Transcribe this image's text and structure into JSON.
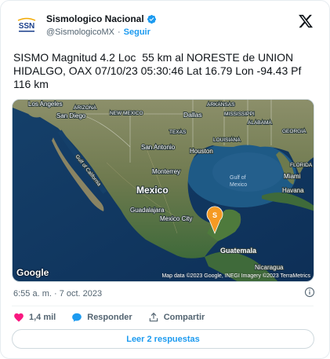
{
  "author": {
    "name": "Sismologico Nacional",
    "handle": "@SismologicoMX",
    "follow_label": "Seguir",
    "avatar_text": "SSN"
  },
  "tweet": {
    "text": "SISMO Magnitud 4.2 Loc  55 km al NORESTE de UNION HIDALGO, OAX 07/10/23 05:30:46 Lat 16.79 Lon -94.43 Pf 116 km"
  },
  "map": {
    "labels": {
      "los_angeles": "Los Angeles",
      "arizona": "ARIZONA",
      "arkansas": "ARKANSAS",
      "san_diego": "San Diego",
      "new_mexico": "NEW MEXICO",
      "mississippi": "MISSISSIPPI",
      "dallas": "Dallas",
      "alabama": "ALABAMA",
      "texas": "TEXAS",
      "georgia": "GEORGIA",
      "louisiana": "LOUISIANA",
      "san_antonio": "San Antonio",
      "houston": "Houston",
      "florida": "FLORIDA",
      "gulf_of_california": "Gulf of California",
      "monterrey": "Monterrey",
      "gulf_of_mexico_1": "Gulf of",
      "gulf_of_mexico_2": "Mexico",
      "miami": "Miami",
      "mexico": "Mexico",
      "havana": "Havana",
      "guadalajara": "Guadalajara",
      "mexico_city": "Mexico City",
      "guatemala": "Guatemala",
      "nicaragua": "Nicaragua"
    },
    "marker_letter": "S",
    "google": "Google",
    "credit": "Map data ©2023 Google, INEGI Imagery ©2023 TerraMetrics"
  },
  "meta": {
    "timestamp": "6:55 a. m. · 7 oct. 2023"
  },
  "actions": {
    "likes": "1,4 mil",
    "reply": "Responder",
    "share": "Compartir"
  },
  "replies_button": "Leer 2 respuestas",
  "colors": {
    "accent": "#1d9bf0",
    "like": "#f91880",
    "marker": "#f59a23",
    "text_secondary": "#536471"
  }
}
